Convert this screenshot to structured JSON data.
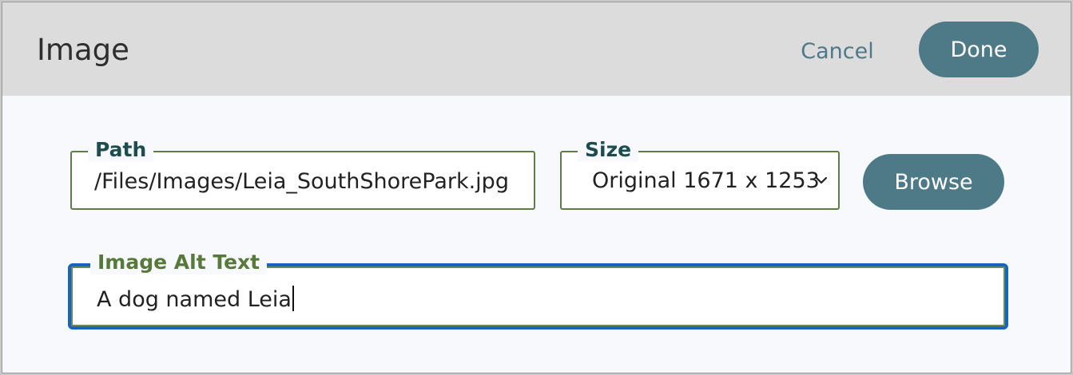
{
  "dialog": {
    "title": "Image",
    "cancel_label": "Cancel",
    "done_label": "Done"
  },
  "path": {
    "label": "Path",
    "value": "/Files/Images/Leia_SouthShorePark.jpg"
  },
  "size": {
    "label": "Size",
    "selected": "Original 1671 x 1253",
    "icon": "chevron-down-icon"
  },
  "browse_label": "Browse",
  "alt_text": {
    "label": "Image Alt Text",
    "value": "A dog named Leia"
  },
  "colors": {
    "accent": "#4e7a88",
    "focus_border": "#1565c0",
    "field_border": "#5f7d4a",
    "header_bg": "#dcdcdc"
  }
}
